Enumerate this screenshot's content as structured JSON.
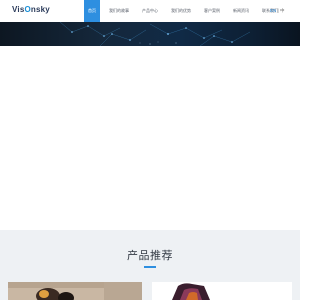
{
  "header": {
    "logo_text": "VisOnsky",
    "nav": [
      {
        "label": "首页",
        "active": true
      },
      {
        "label": "我们的故事",
        "active": false
      },
      {
        "label": "产品中心",
        "active": false
      },
      {
        "label": "我们的优势",
        "active": false
      },
      {
        "label": "客户案例",
        "active": false
      },
      {
        "label": "新闻资讯",
        "active": false
      },
      {
        "label": "联系我们",
        "active": false
      }
    ],
    "lang_en": "EN",
    "lang_sep": "|",
    "lang_zh": "中"
  },
  "products_section": {
    "title": "产品推荐"
  },
  "colors": {
    "accent": "#2e8fe0",
    "section_bg": "#eef1f4",
    "hero_bg": "#102a46"
  }
}
